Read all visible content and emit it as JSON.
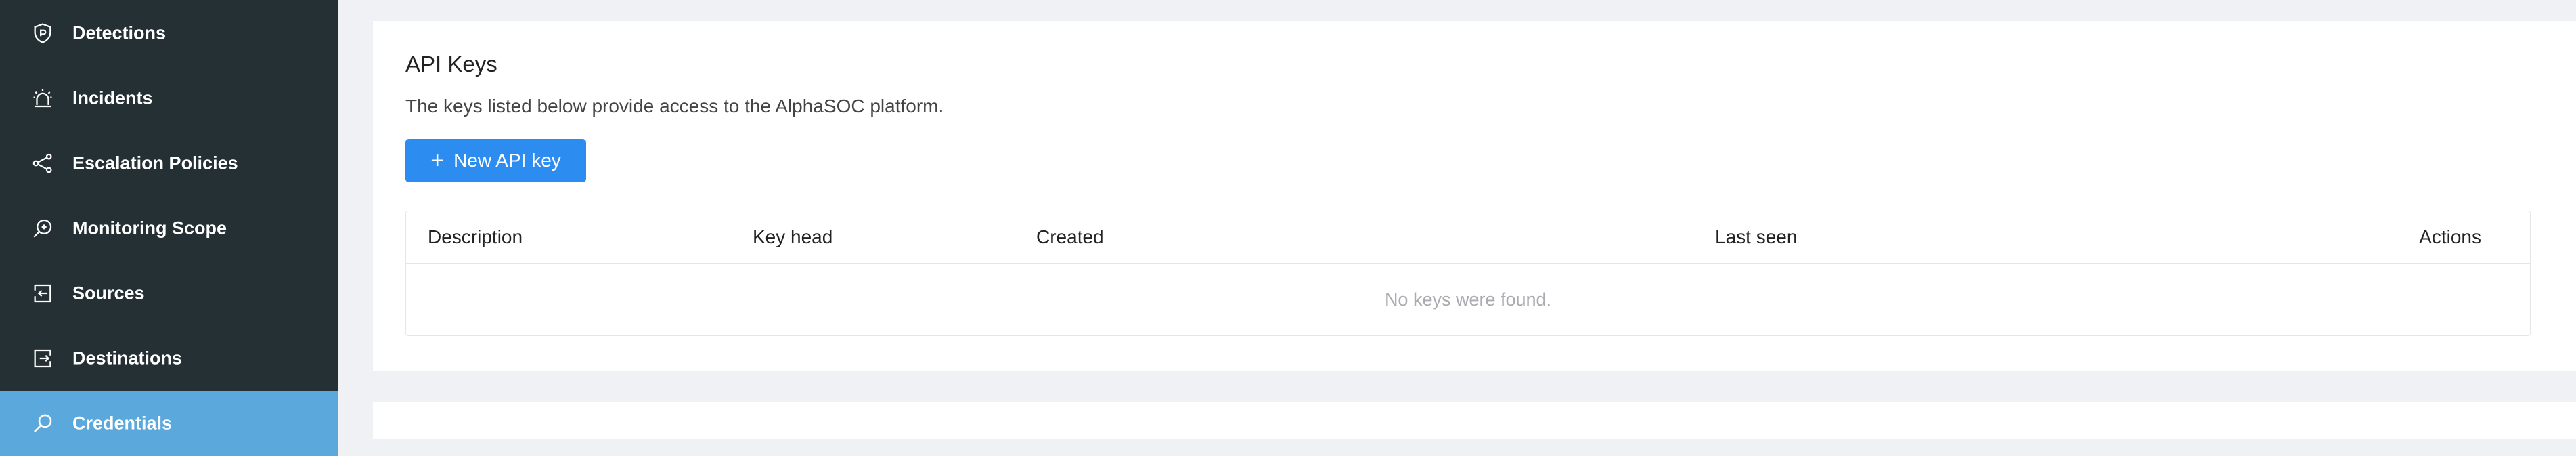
{
  "sidebar": {
    "items": [
      {
        "label": "Detections",
        "icon": "shield-icon",
        "active": false
      },
      {
        "label": "Incidents",
        "icon": "alarm-icon",
        "active": false
      },
      {
        "label": "Escalation Policies",
        "icon": "share-icon",
        "active": false
      },
      {
        "label": "Monitoring Scope",
        "icon": "scope-icon",
        "active": false
      },
      {
        "label": "Sources",
        "icon": "import-icon",
        "active": false
      },
      {
        "label": "Destinations",
        "icon": "export-icon",
        "active": false
      },
      {
        "label": "Credentials",
        "icon": "key-icon",
        "active": true
      }
    ]
  },
  "main": {
    "title": "API Keys",
    "description": "The keys listed below provide access to the AlphaSOC platform.",
    "new_key_button": "New API key",
    "table": {
      "columns": [
        "Description",
        "Key head",
        "Created",
        "Last seen",
        "Actions"
      ],
      "empty_text": "No keys were found."
    }
  },
  "colors": {
    "sidebar_bg": "#243033",
    "active_item_bg": "#5ba8dd",
    "primary_button": "#2d8cf0",
    "page_bg": "#eff1f4"
  }
}
